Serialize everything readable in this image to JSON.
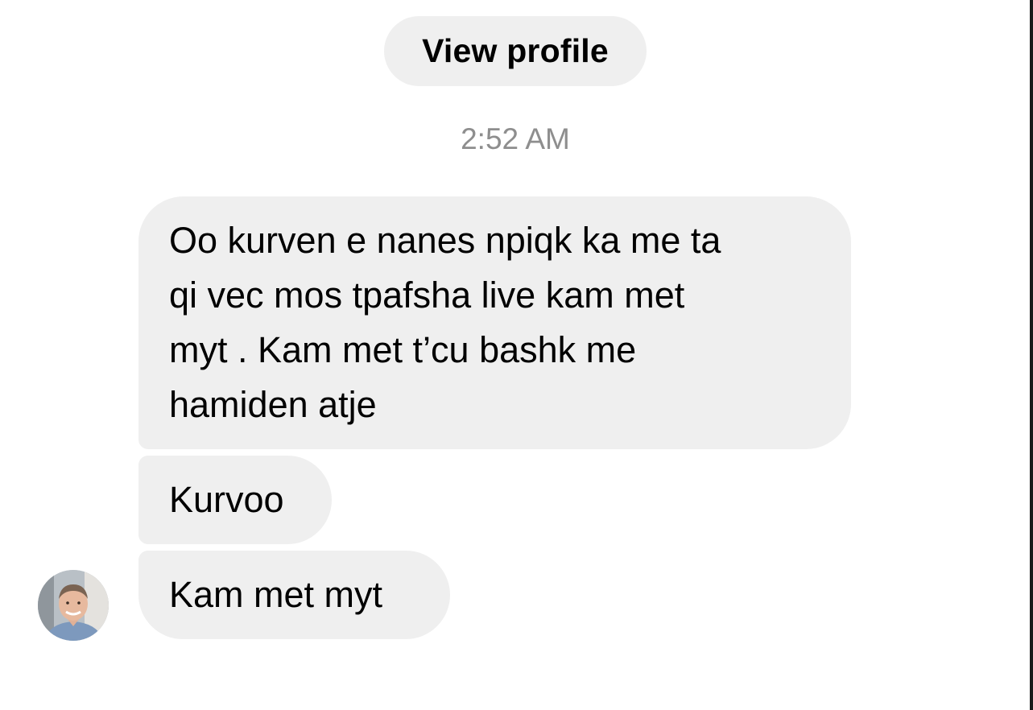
{
  "header": {
    "view_profile_label": "View profile"
  },
  "thread": {
    "timestamp": "2:52 AM",
    "messages": [
      {
        "lines": [
          "Oo kurven e nanes npiqk ka me ta",
          "qi vec mos tpafsha live kam met",
          "myt . Kam met t’cu bashk me",
          "hamiden atje"
        ]
      },
      {
        "text": "Kurvoo"
      },
      {
        "text": "Kam met myt"
      }
    ]
  },
  "sender": {
    "avatar_icon": "profile-photo-avatar"
  },
  "colors": {
    "bubble_background": "#efefef",
    "timestamp_text": "#8e8e8e",
    "page_background": "#ffffff"
  }
}
